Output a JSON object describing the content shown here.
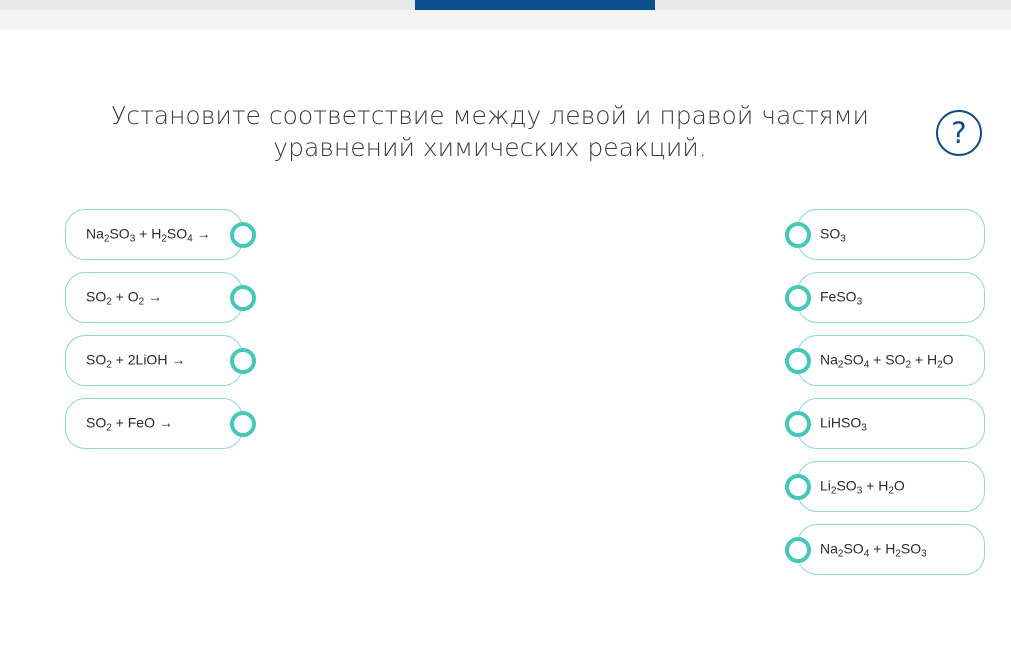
{
  "question": "Установите соответствие между левой и правой частями уравнений химических реакций.",
  "help_icon": "?",
  "colors": {
    "accent": "#46c8b8",
    "border": "#8ed9d2",
    "nav_active": "#0b4f8c",
    "help": "#114d80"
  },
  "left_items": [
    {
      "label": "Na<sub>2</sub>SO<sub>3</sub> + H<sub>2</sub>SO<sub>4</sub> →"
    },
    {
      "label": "SO<sub>2</sub> + O<sub>2</sub> →"
    },
    {
      "label": "SO<sub>2</sub> + 2LiOH →"
    },
    {
      "label": "SO<sub>2</sub> + FeO →"
    }
  ],
  "right_items": [
    {
      "label": "SO<sub>3</sub>"
    },
    {
      "label": "FeSO<sub>3</sub>"
    },
    {
      "label": "Na<sub>2</sub>SO<sub>4</sub> + SO<sub>2</sub> + H<sub>2</sub>O"
    },
    {
      "label": "LiHSO<sub>3</sub>"
    },
    {
      "label": "Li<sub>2</sub>SO<sub>3</sub> + H<sub>2</sub>O"
    },
    {
      "label": "Na<sub>2</sub>SO<sub>4</sub> + H<sub>2</sub>SO<sub>3</sub>"
    }
  ]
}
